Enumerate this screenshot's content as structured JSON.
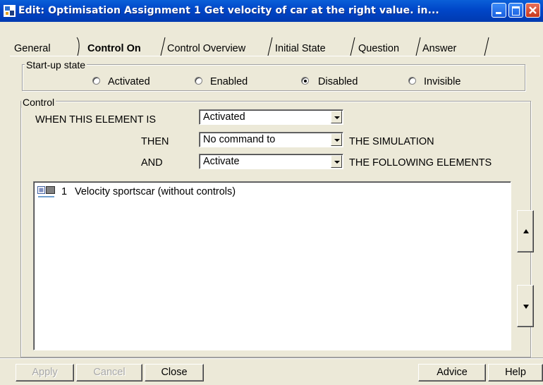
{
  "window": {
    "title": "Edit:  Optimisation Assignment 1  Get velocity of car at the right value.  in..."
  },
  "icons": {
    "app": "element-edit-icon",
    "minimize": "minimize-icon",
    "maximize": "maximize-icon",
    "close": "close-icon",
    "list_item": "element-icon",
    "move_up": "arrow-up-icon",
    "move_down": "arrow-down-icon"
  },
  "tabs": [
    {
      "label": "General",
      "active": false
    },
    {
      "label": "Control On",
      "active": true
    },
    {
      "label": "Control Overview",
      "active": false
    },
    {
      "label": "Initial State",
      "active": false
    },
    {
      "label": "Question",
      "active": false
    },
    {
      "label": "Answer",
      "active": false
    }
  ],
  "startup": {
    "legend": "Start-up state",
    "options": [
      {
        "label": "Activated",
        "selected": false
      },
      {
        "label": "Enabled",
        "selected": false
      },
      {
        "label": "Disabled",
        "selected": true
      },
      {
        "label": "Invisible",
        "selected": false
      }
    ]
  },
  "control": {
    "legend": "Control",
    "when_label": "WHEN THIS ELEMENT IS",
    "when_value": "Activated",
    "then_label": "THEN",
    "then_value": "No command to",
    "then_suffix": "THE SIMULATION",
    "and_label": "AND",
    "and_value": "Activate",
    "and_suffix": "THE FOLLOWING ELEMENTS"
  },
  "elements_list": [
    {
      "number": "1",
      "name": "Velocity sportscar (without controls)"
    }
  ],
  "buttons": {
    "apply": "Apply",
    "cancel": "Cancel",
    "close": "Close",
    "advice": "Advice",
    "help": "Help"
  },
  "colors": {
    "titlebar": "#0046c8",
    "face": "#ece9d8",
    "close_button": "#c8381c"
  }
}
